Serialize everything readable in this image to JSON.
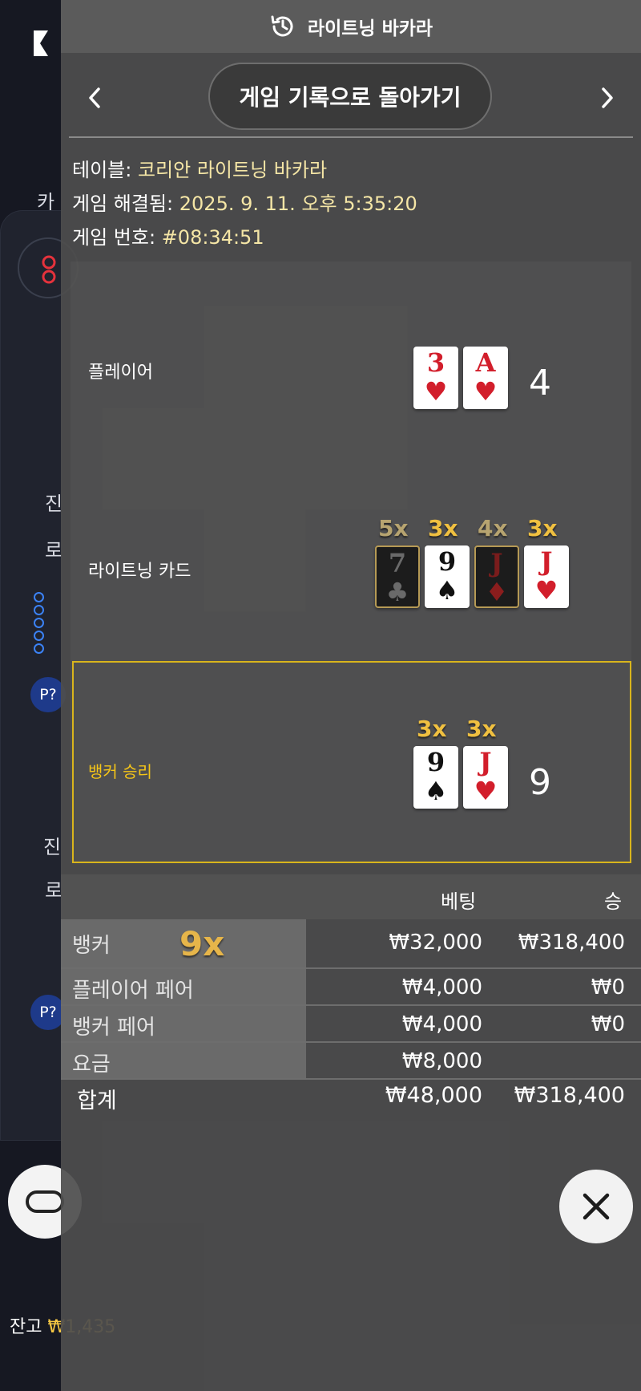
{
  "background": {
    "chip_label": "P?",
    "balance_label": "잔고",
    "balance_amount": "₩1,435",
    "partial_texts": [
      "카",
      "진",
      "로",
      "₩"
    ]
  },
  "header": {
    "title": "라이트닝 바카라",
    "icon": "history-icon"
  },
  "nav": {
    "back_label": "게임 기록으로 돌아가기",
    "prev_icon": "chevron-left-icon",
    "next_icon": "chevron-right-icon"
  },
  "info": {
    "table_label": "테이블:",
    "table_value": "코리안 라이트닝 바카라",
    "resolved_label": "게임 해결됨:",
    "resolved_value": "2025. 9. 11. 오후 5:35:20",
    "number_label": "게임 번호:",
    "number_value": "#08:34:51"
  },
  "player": {
    "label": "플레이어",
    "score": "4",
    "cards": [
      {
        "rank": "3",
        "suit": "♥"
      },
      {
        "rank": "A",
        "suit": "♥"
      }
    ]
  },
  "lightning": {
    "label": "라이트닝 카드",
    "cards": [
      {
        "rank": "7",
        "suit": "♣",
        "mult": "5x"
      },
      {
        "rank": "9",
        "suit": "♠",
        "mult": "3x"
      },
      {
        "rank": "J",
        "suit": "♦",
        "mult": "4x"
      },
      {
        "rank": "J",
        "suit": "♥",
        "mult": "3x"
      }
    ]
  },
  "banker": {
    "label": "뱅커 승리",
    "score": "9",
    "cards": [
      {
        "rank": "9",
        "suit": "♠",
        "mult": "3x"
      },
      {
        "rank": "J",
        "suit": "♥",
        "mult": "3x"
      }
    ]
  },
  "bets": {
    "col_bet": "베팅",
    "col_win": "승",
    "multiplier": "9x",
    "rows": [
      {
        "name": "뱅커",
        "bet": "₩32,000",
        "win": "₩318,400"
      },
      {
        "name": "플레이어 페어",
        "bet": "₩4,000",
        "win": "₩0"
      },
      {
        "name": "뱅커 페어",
        "bet": "₩4,000",
        "win": "₩0"
      },
      {
        "name": "요금",
        "bet": "₩8,000",
        "win": ""
      }
    ],
    "total_label": "합계",
    "total_bet": "₩48,000",
    "total_win": "₩318,400"
  },
  "colors": {
    "gold": "#f5c518",
    "panel": "#4e4e4e",
    "card_red": "#d21e2b"
  },
  "close_icon": "close-icon"
}
